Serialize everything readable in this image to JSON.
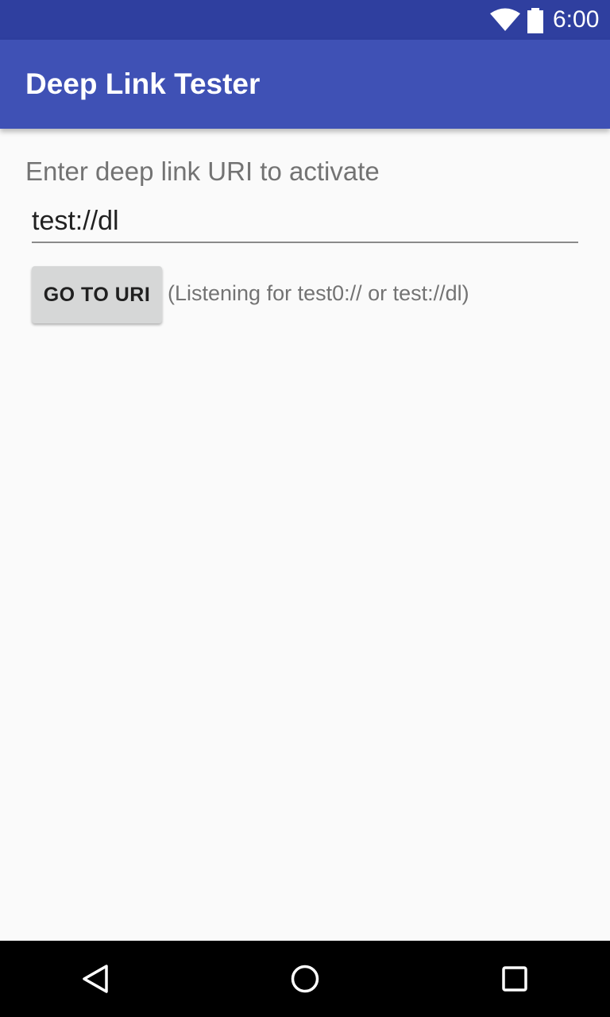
{
  "status_bar": {
    "time": "6:00",
    "icons": [
      "wifi-icon",
      "battery-icon"
    ]
  },
  "app_bar": {
    "title": "Deep Link Tester",
    "color": "#3f51b5"
  },
  "main": {
    "prompt_label": "Enter deep link URI to activate",
    "uri_input_value": "test://dl",
    "go_button_label": "GO TO URI",
    "listening_text": "(Listening for test0:// or test://dl)"
  },
  "nav_bar": {
    "buttons": [
      "back-icon",
      "home-icon",
      "recents-icon"
    ]
  },
  "colors": {
    "status_bar": "#2f3f9f",
    "app_bar": "#3f51b5",
    "background": "#fafafa",
    "button": "#d6d7d7"
  }
}
